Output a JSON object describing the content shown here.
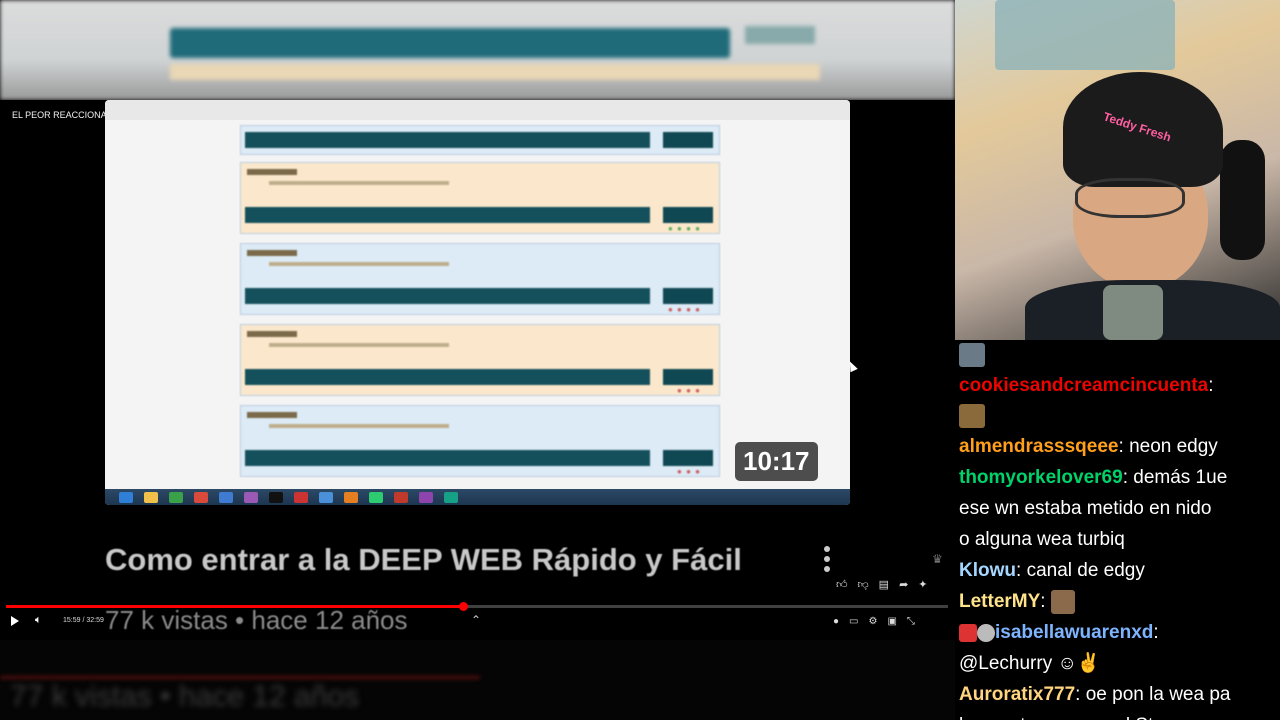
{
  "player": {
    "video_title": "EL PEOR REACCIONADOR DE TIKTOK | Canal de Pancho",
    "thumbnail_duration": "10:17",
    "big_title": "Como entrar a la DEEP WEB Rápido y Fácil",
    "views_line": "77 k vistas • hace 12 años",
    "time_display": "15:59 / 32:59",
    "progress_fraction": 0.485
  },
  "chat": {
    "messages": [
      {
        "user": "cookiesandcreamcincuenta",
        "color": "#eb0400",
        "text": ""
      },
      {
        "user": "almendrasssqeee",
        "color": "#ff9f1a",
        "text": "neon edgy"
      },
      {
        "user": "thomyorkelover69",
        "color": "#00d26a",
        "text": "demás 1ue"
      },
      {
        "user": "",
        "color": "#ffffff",
        "text": "ese wn estaba metido en nido"
      },
      {
        "user": "",
        "color": "#ffffff",
        "text": "o alguna wea turbiq"
      },
      {
        "user": "Klowu",
        "color": "#a5d6ff",
        "text": "canal de edgy"
      },
      {
        "user": "LetterMY",
        "color": "#ffe38a",
        "text": ""
      },
      {
        "user": "isabellawuarenxd",
        "color": "#7db4ff",
        "text": ""
      },
      {
        "user": "",
        "color": "#ffffff",
        "text": "@Lechurry"
      },
      {
        "user": "Auroratix777",
        "color": "#ffd580",
        "text": "oe pon la wea pa"
      },
      {
        "user": "",
        "color": "#ffffff",
        "text": "los puntos por ver el Stream"
      }
    ]
  },
  "webcam": {
    "beanie_text": "Teddy Fresh"
  },
  "colors": {
    "progress": "#ff0000",
    "chat_bg": "#000000"
  }
}
